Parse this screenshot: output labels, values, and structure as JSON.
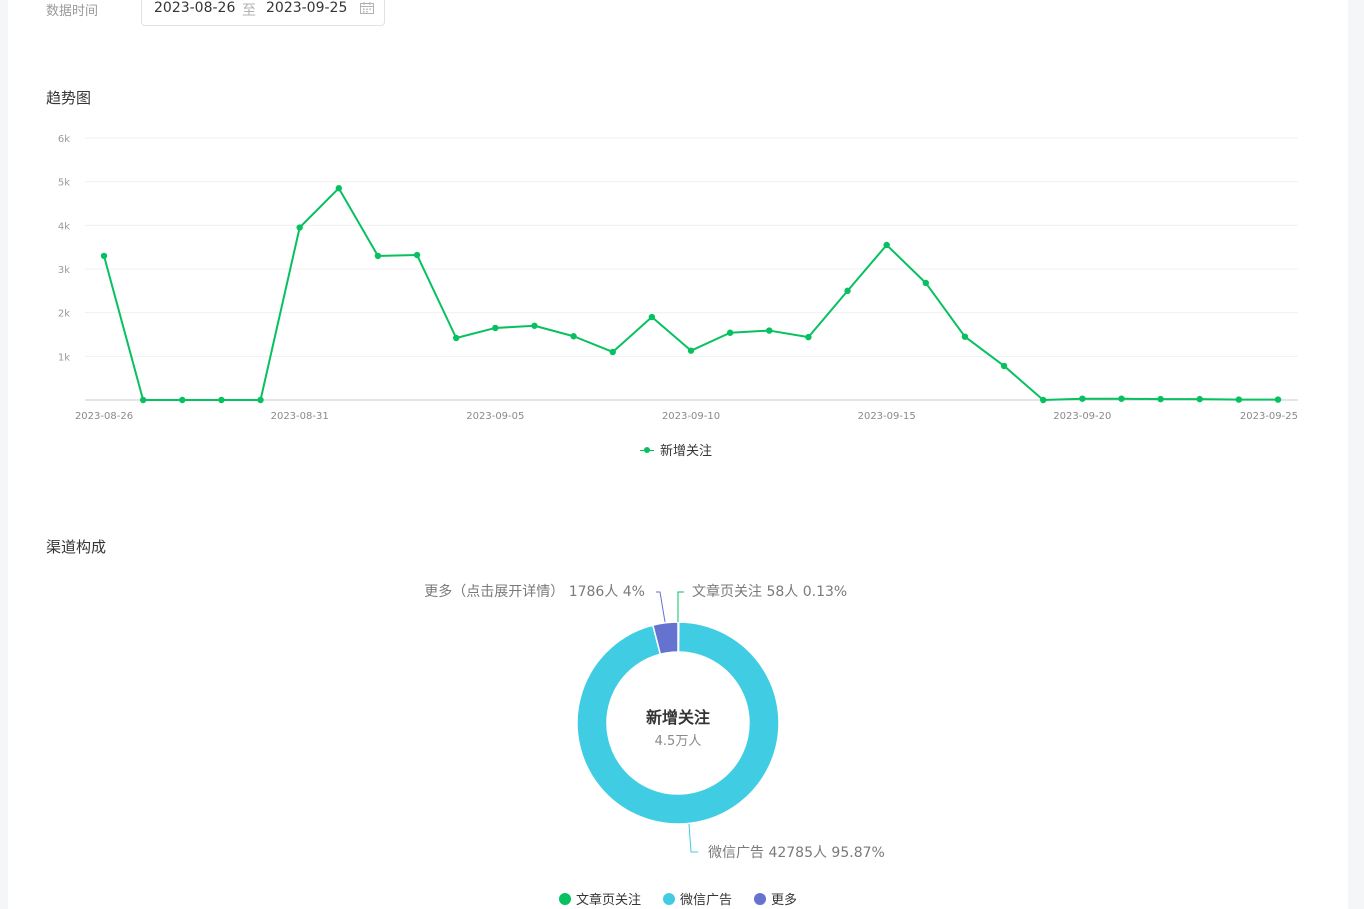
{
  "filter": {
    "label": "数据时间",
    "start_date": "2023-08-26",
    "separator": "至",
    "end_date": "2023-09-25"
  },
  "trend_section": {
    "title": "趋势图"
  },
  "channel_section": {
    "title": "渠道构成"
  },
  "chart_data": [
    {
      "type": "line",
      "title": "趋势图",
      "x": [
        "2023-08-26",
        "2023-08-27",
        "2023-08-28",
        "2023-08-29",
        "2023-08-30",
        "2023-08-31",
        "2023-09-01",
        "2023-09-02",
        "2023-09-03",
        "2023-09-04",
        "2023-09-05",
        "2023-09-06",
        "2023-09-07",
        "2023-09-08",
        "2023-09-09",
        "2023-09-10",
        "2023-09-11",
        "2023-09-12",
        "2023-09-13",
        "2023-09-14",
        "2023-09-15",
        "2023-09-16",
        "2023-09-17",
        "2023-09-18",
        "2023-09-19",
        "2023-09-20",
        "2023-09-21",
        "2023-09-22",
        "2023-09-23",
        "2023-09-24",
        "2023-09-25"
      ],
      "x_tick_labels": [
        "2023-08-26",
        "2023-08-31",
        "2023-09-05",
        "2023-09-10",
        "2023-09-15",
        "2023-09-20",
        "2023-09-25"
      ],
      "y_ticks": [
        1000,
        2000,
        3000,
        4000,
        5000,
        6000
      ],
      "y_tick_labels": [
        "1k",
        "2k",
        "3k",
        "4k",
        "5k",
        "6k"
      ],
      "ylim": [
        0,
        6000
      ],
      "grid": true,
      "legend_position": "bottom-center",
      "series": [
        {
          "name": "新增关注",
          "color": "#07c160",
          "values": [
            3300,
            0,
            0,
            0,
            0,
            3950,
            4850,
            3300,
            3320,
            1420,
            1650,
            1700,
            1460,
            1100,
            1900,
            1130,
            1540,
            1590,
            1440,
            2500,
            3550,
            2680,
            1450,
            780,
            0,
            30,
            30,
            20,
            20,
            10,
            10
          ]
        }
      ]
    },
    {
      "type": "pie",
      "title": "渠道构成",
      "donut": true,
      "center_title": "新增关注",
      "center_value": "4.5万人",
      "legend_position": "bottom-center",
      "slices": [
        {
          "name": "文章页关注",
          "value": 58,
          "percent": 0.13,
          "label": "文章页关注 58人 0.13%",
          "color": "#07c160"
        },
        {
          "name": "微信广告",
          "value": 42785,
          "percent": 95.87,
          "label": "微信广告 42785人 95.87%",
          "color": "#40cde3"
        },
        {
          "name": "更多",
          "value": 1786,
          "percent": 4,
          "label": "更多（点击展开详情） 1786人 4%",
          "color": "#6572d0"
        }
      ]
    }
  ]
}
